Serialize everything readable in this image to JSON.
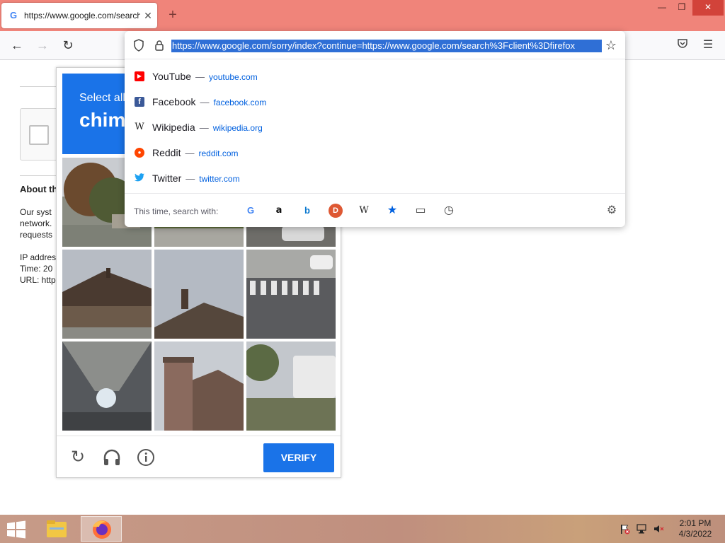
{
  "browser": {
    "tab": {
      "title": "https://www.google.com/search?client=firefox-b-d&q=",
      "close_glyph": "✕",
      "favicon": "G"
    },
    "new_tab_glyph": "+",
    "window_controls": {
      "minimize": "—",
      "restore": "❐",
      "close": "✕"
    },
    "nav": {
      "back": "←",
      "forward": "→",
      "reload": "↻"
    },
    "url": "https://www.google.com/sorry/index?continue=https://www.google.com/search%3Fclient%3Dfirefox",
    "toolbar_right": {
      "pocket": "pocket-icon",
      "menu": "☰"
    }
  },
  "suggestions": [
    {
      "name": "YouTube",
      "url": "youtube.com",
      "icon": "▶",
      "color": "#ff0000"
    },
    {
      "name": "Facebook",
      "url": "facebook.com",
      "icon": "f",
      "color": "#1877f2"
    },
    {
      "name": "Wikipedia",
      "url": "wikipedia.org",
      "icon": "W",
      "color": "#ffffff"
    },
    {
      "name": "Reddit",
      "url": "reddit.com",
      "icon": "●",
      "color": "#ff4500"
    },
    {
      "name": "Twitter",
      "url": "twitter.com",
      "icon": "🐦",
      "color": "#1da1f2"
    }
  ],
  "dash": "—",
  "search_with": {
    "label": "This time, search with:",
    "engines": [
      "G",
      "a",
      "b",
      "D",
      "W",
      "★",
      "▭",
      "◷"
    ],
    "settings": "⚙"
  },
  "page": {
    "about_heading": "About th",
    "body_lines": [
      "Our syst",
      "network.",
      "requests"
    ],
    "ip_line": "IP addres",
    "time_line": "Time: 20",
    "url_line": "URL: http"
  },
  "captcha": {
    "instruction_small": "Select all",
    "instruction_big": "chimn",
    "verify_label": "VERIFY",
    "footer_icons": [
      "reload-icon",
      "audio-icon",
      "info-icon"
    ]
  },
  "taskbar": {
    "clock_time": "2:01 PM",
    "clock_date": "4/3/2022"
  },
  "colors": {
    "tabstrip": "#f0847a",
    "accent": "#1a73e8",
    "url_highlight": "#2f6fd6",
    "link": "#0060df"
  }
}
